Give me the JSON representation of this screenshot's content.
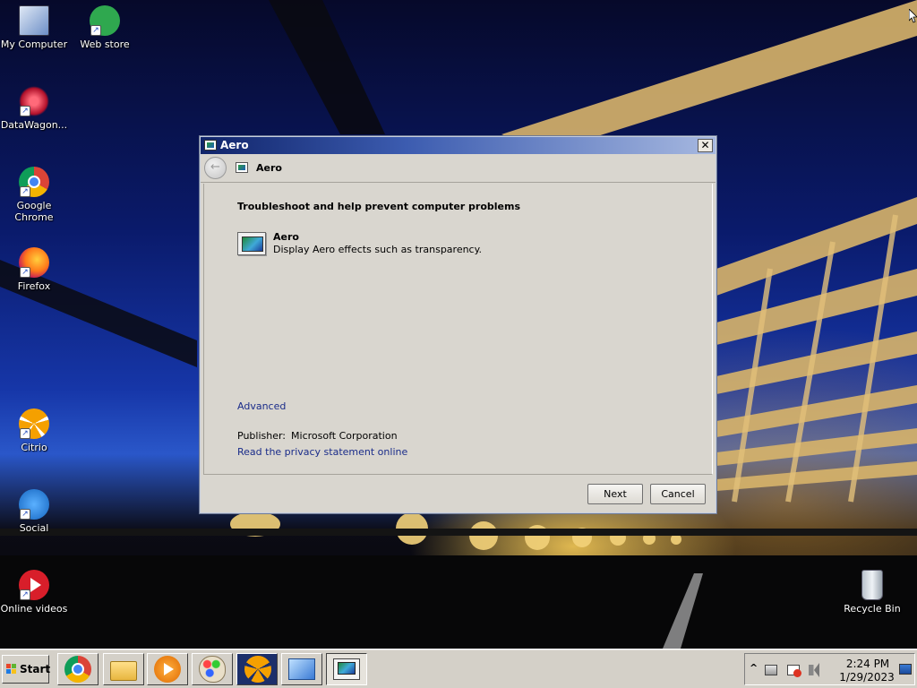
{
  "desktop": {
    "icons": [
      {
        "label": "My Computer",
        "icon": "computer-icon"
      },
      {
        "label": "Web store",
        "icon": "store-icon"
      },
      {
        "label": "DataWagon...",
        "icon": "datawagon-icon"
      },
      {
        "label": "Google Chrome",
        "icon": "chrome-icon"
      },
      {
        "label": "Firefox",
        "icon": "firefox-icon"
      },
      {
        "label": "Citrio",
        "icon": "citrio-icon"
      },
      {
        "label": "Social",
        "icon": "social-icon"
      },
      {
        "label": "Online videos",
        "icon": "video-icon"
      },
      {
        "label": "Recycle Bin",
        "icon": "recycle-bin-icon"
      }
    ]
  },
  "dialog": {
    "title": "Aero",
    "nav_title": "Aero",
    "close_glyph": "✕",
    "back_glyph": "←",
    "heading": "Troubleshoot and help prevent computer problems",
    "troubleshooter": {
      "name": "Aero",
      "description": "Display Aero effects such as transparency."
    },
    "advanced_link": "Advanced",
    "publisher_label": "Publisher:",
    "publisher_value": "Microsoft Corporation",
    "privacy_link": "Read the privacy statement online",
    "next_label": "Next",
    "cancel_label": "Cancel"
  },
  "taskbar": {
    "start_label": "Start",
    "apps": [
      "chrome-icon",
      "file-explorer-icon",
      "media-player-icon",
      "paint-icon",
      "citrio-icon",
      "control-panel-icon",
      "aero-troubleshooter-icon"
    ],
    "tray_arrow": "^",
    "clock_time": "2:24 PM",
    "clock_date": "1/29/2023"
  },
  "colors": {
    "dialog_bg": "#d9d6cf",
    "titlebar_start": "#10246a",
    "titlebar_end": "#a6b8e0",
    "link": "#1a2c8a",
    "taskbar": "#d4d0c8"
  }
}
